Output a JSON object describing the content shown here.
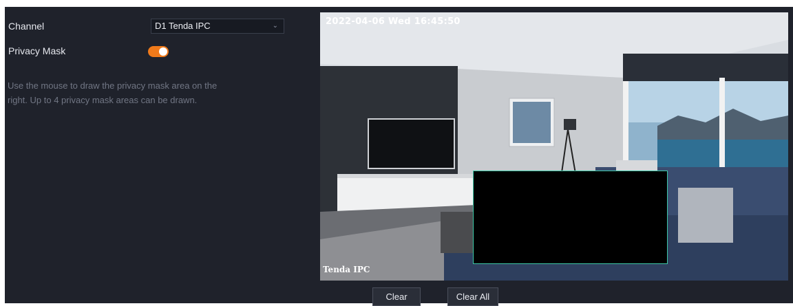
{
  "form": {
    "channel_label": "Channel",
    "channel_value": "D1 Tenda IPC",
    "privacy_mask_label": "Privacy Mask",
    "privacy_mask_enabled": true,
    "hint": "Use the mouse to draw the privacy mask area on the right. Up to 4 privacy mask areas can be drawn."
  },
  "preview": {
    "osd_datetime": "2022-04-06   Wed   16:45:50",
    "osd_channel_name": "Tenda IPC",
    "mask_count": 1
  },
  "buttons": {
    "clear": "Clear",
    "clear_all": "Clear All"
  },
  "colors": {
    "panel_bg": "#1f222b",
    "toggle_on": "#f07a1a",
    "mask_border": "#3ec9a8"
  },
  "icons": {
    "select_chevron": "chevron-down-icon"
  }
}
